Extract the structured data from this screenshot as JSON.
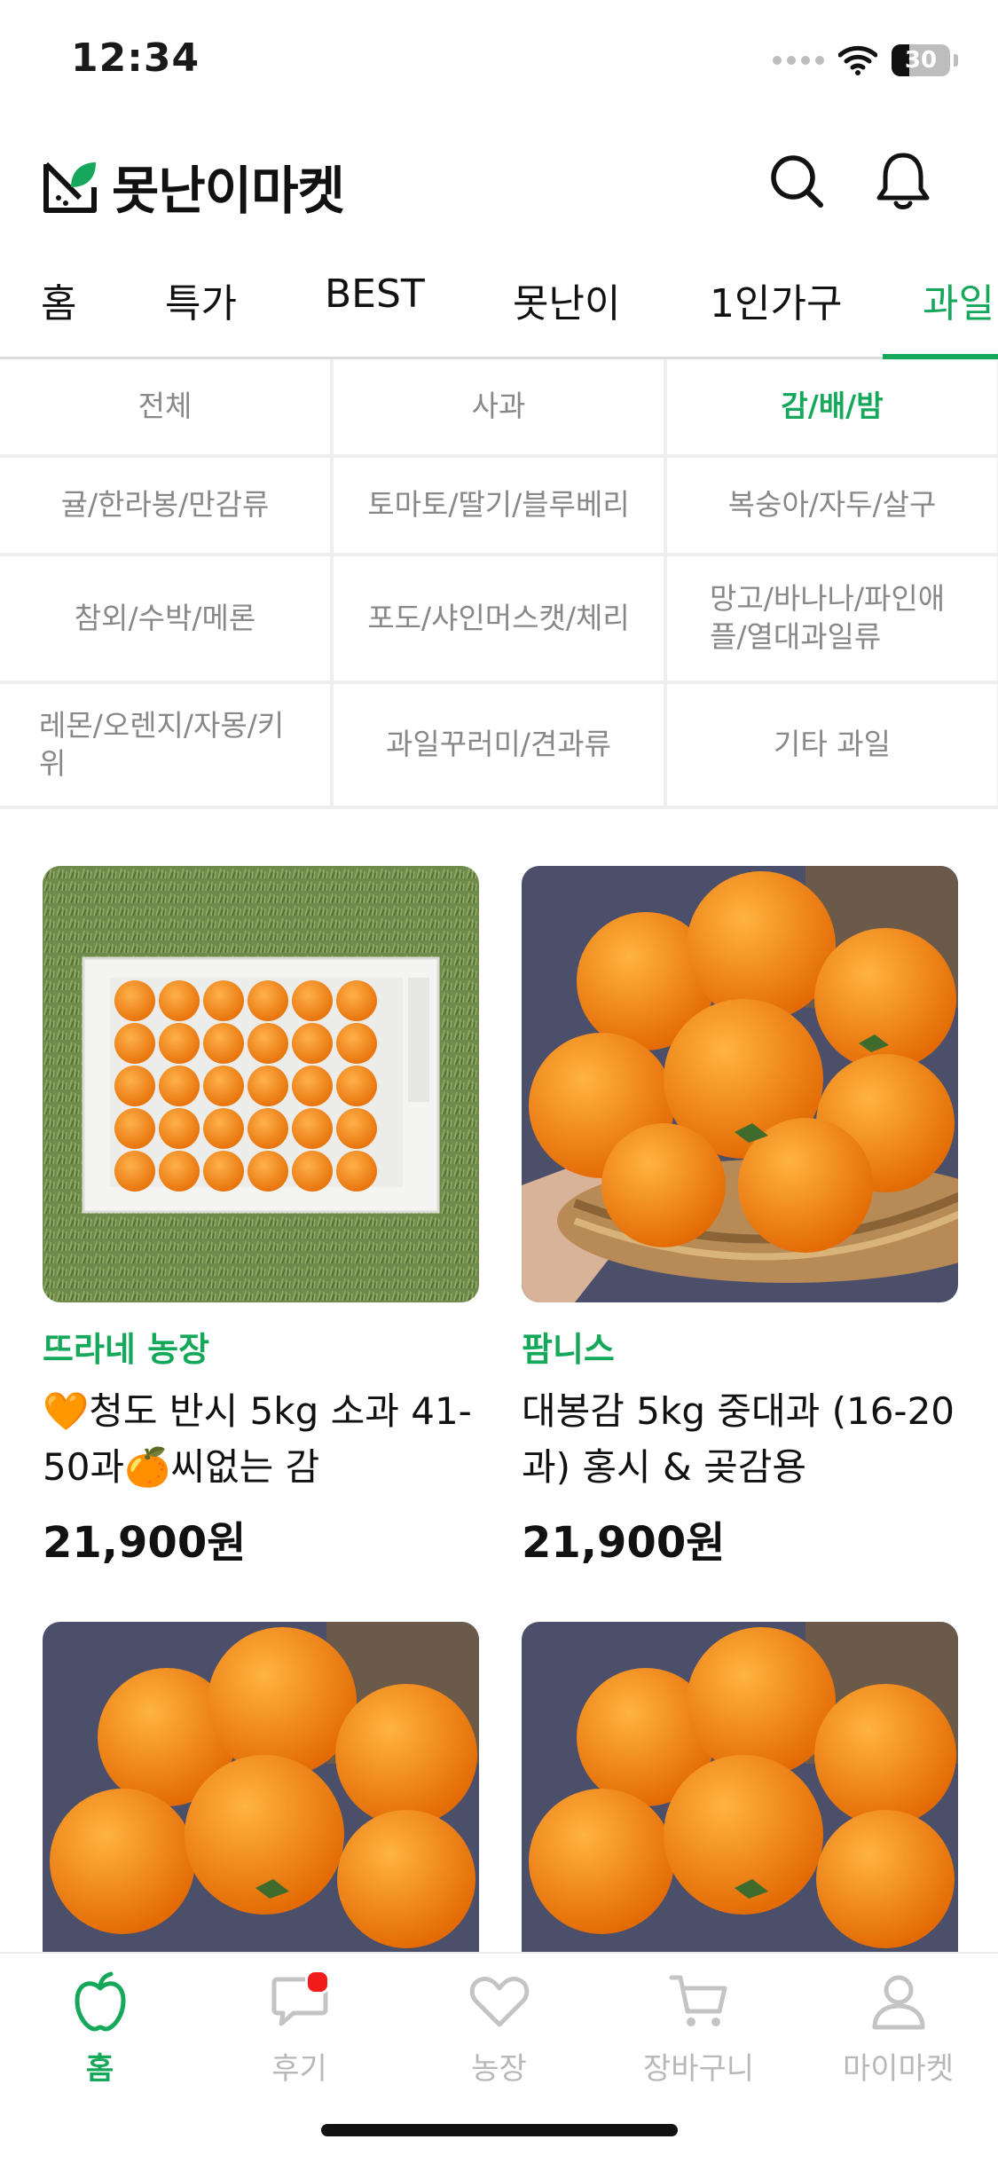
{
  "status": {
    "time": "12:34",
    "battery": "30",
    "battery_level": 0.3
  },
  "header": {
    "app_name": "못난이마켓"
  },
  "tabs": [
    {
      "label": "홈"
    },
    {
      "label": "특가"
    },
    {
      "label": "BEST"
    },
    {
      "label": "못난이"
    },
    {
      "label": "1인가구"
    },
    {
      "label": "과일",
      "active": true
    }
  ],
  "categories": [
    {
      "label": "전체"
    },
    {
      "label": "사과"
    },
    {
      "label": "감/배/밤",
      "active": true
    },
    {
      "label": "귤/한라봉/만감류"
    },
    {
      "label": "토마토/딸기/블루베리"
    },
    {
      "label": "복숭아/자두/살구"
    },
    {
      "label": "참외/수박/메론"
    },
    {
      "label": "포도/샤인머스캣/체리"
    },
    {
      "label": "망고/바나나/파인애플/열대과일류"
    },
    {
      "label": "레몬/오렌지/자몽/키위"
    },
    {
      "label": "과일꾸러미/견과류"
    },
    {
      "label": "기타 과일"
    }
  ],
  "products": [
    {
      "farm": "뜨라네 농장",
      "name": "🧡청도 반시 5kg 소과 41-50과🍊씨없는 감",
      "price": "21,900원"
    },
    {
      "farm": "팜니스",
      "name": "대봉감 5kg 중대과 (16-20과) 홍시 & 곶감용",
      "price": "21,900원"
    },
    {
      "farm": "",
      "name": "",
      "price": ""
    },
    {
      "farm": "",
      "name": "",
      "price": ""
    }
  ],
  "bottom_nav": [
    {
      "label": "홈",
      "icon": "apple-icon",
      "active": true
    },
    {
      "label": "후기",
      "icon": "chat-bubble-icon",
      "badge": true
    },
    {
      "label": "농장",
      "icon": "heart-icon"
    },
    {
      "label": "장바구니",
      "icon": "cart-icon"
    },
    {
      "label": "마이마켓",
      "icon": "profile-icon"
    }
  ],
  "colors": {
    "accent": "#15a85a",
    "badge": "#f21b1b"
  }
}
